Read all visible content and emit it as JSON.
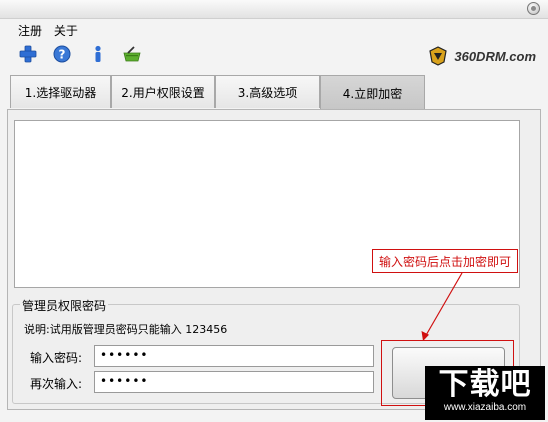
{
  "menu": {
    "items": [
      "注册",
      "关于"
    ]
  },
  "toolbar": {
    "icons": [
      "add-icon",
      "help-icon",
      "info-icon",
      "basket-icon"
    ]
  },
  "logo": {
    "text": "360DRM.com"
  },
  "tabs": [
    {
      "label": "1.选择驱动器"
    },
    {
      "label": "2.用户权限设置"
    },
    {
      "label": "3.高级选项"
    },
    {
      "label": "4.立即加密"
    }
  ],
  "group": {
    "title": "管理员权限密码",
    "note": "说明:试用版管理员密码只能输入 123456",
    "password_label": "输入密码:",
    "password_value": "••••••",
    "confirm_label": "再次输入:",
    "confirm_value": "••••••"
  },
  "annotation": {
    "callout": "输入密码后点击加密即可"
  },
  "watermark": {
    "main": "下载吧",
    "url": "www.xiazaiba.com"
  },
  "colors": {
    "annotation": "#d01010",
    "tab_active": "#cccccc"
  }
}
